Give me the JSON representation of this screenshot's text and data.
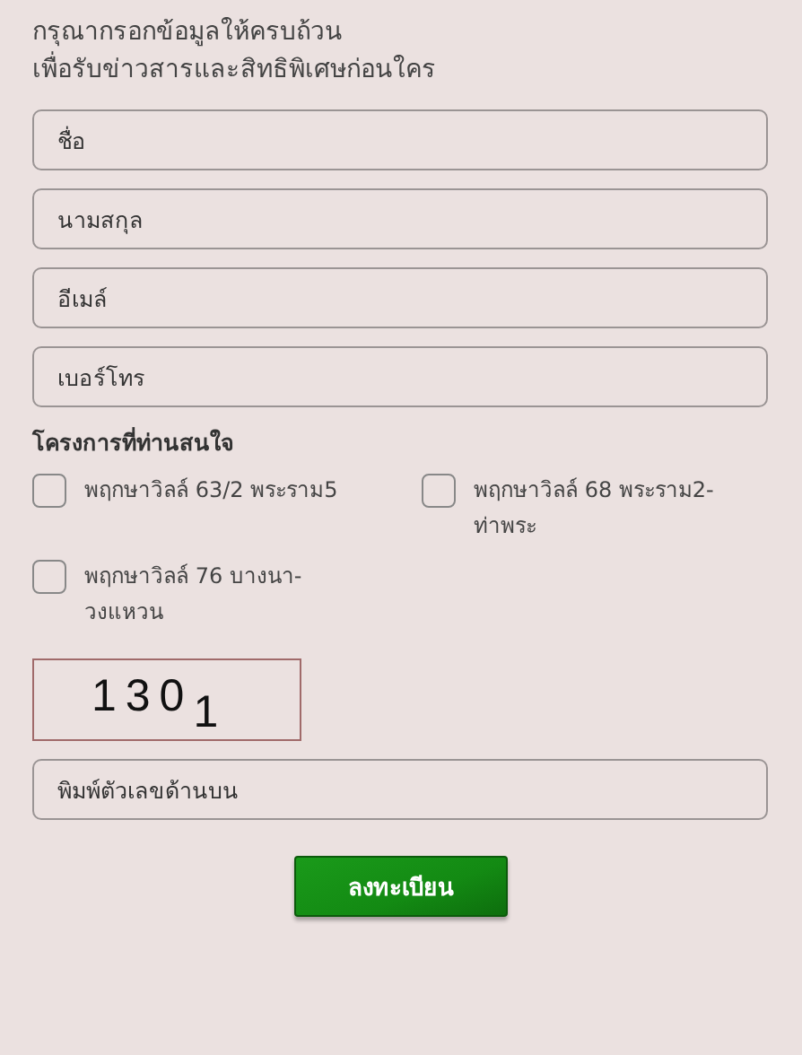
{
  "intro": [
    "กรุณากรอกข้อมูลให้ครบถ้วน",
    "เพื่อรับข่าวสารและสิทธิพิเศษก่อนใคร"
  ],
  "fields": [
    {
      "placeholder": "ชื่อ"
    },
    {
      "placeholder": "นามสกุล"
    },
    {
      "placeholder": "อีเมล์"
    },
    {
      "placeholder": "เบอร์โทร"
    }
  ],
  "interest": {
    "label": "โครงการที่ท่านสนใจ",
    "options": [
      {
        "label": "พฤกษาวิลล์ 63/2 พระราม5",
        "checked": false
      },
      {
        "label": "พฤกษาวิลล์ 68 พระราม2-ท่าพระ",
        "checked": false
      },
      {
        "label": "พฤกษาวิลล์ 76 บางนา-วงแหวน",
        "checked": false
      }
    ]
  },
  "captcha": {
    "code": "130$_{1}$",
    "placeholder": "พิมพ์ตัวเลขด้านบน"
  },
  "submit": "ลงทะเบียน"
}
